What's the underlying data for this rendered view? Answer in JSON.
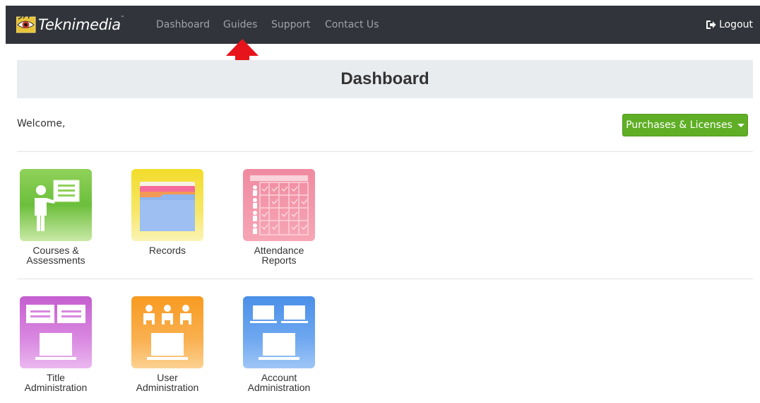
{
  "navbar": {
    "brand": "Teknimedia",
    "brand_tm": "™",
    "links": [
      "Dashboard",
      "Guides",
      "Support",
      "Contact Us"
    ],
    "logout_label": "Logout",
    "bg_color": "#31343a"
  },
  "header": {
    "title": "Dashboard"
  },
  "welcome_text": "Welcome,",
  "purchases_button": {
    "label": "Purchases & Licenses",
    "color": "#5fae25"
  },
  "tiles": [
    {
      "line1": "Courses &",
      "line2": "Assessments",
      "icon": "teacher-board-icon",
      "color": "#6cbf3c"
    },
    {
      "line1": "Records",
      "line2": "",
      "icon": "folder-icon",
      "color": "#f2dc2a"
    },
    {
      "line1": "Attendance",
      "line2": "Reports",
      "icon": "attendance-grid-icon",
      "color": "#f08aa0"
    },
    {
      "line1": "Title",
      "line2": "Administration",
      "icon": "title-admin-icon",
      "color": "#c55ed0"
    },
    {
      "line1": "User",
      "line2": "Administration",
      "icon": "users-admin-icon",
      "color": "#f89a20"
    },
    {
      "line1": "Account",
      "line2": "Administration",
      "icon": "account-admin-icon",
      "color": "#4a8fe8"
    }
  ],
  "annotation": {
    "arrow_color": "#e8141c",
    "arrow_target": "Guides"
  }
}
